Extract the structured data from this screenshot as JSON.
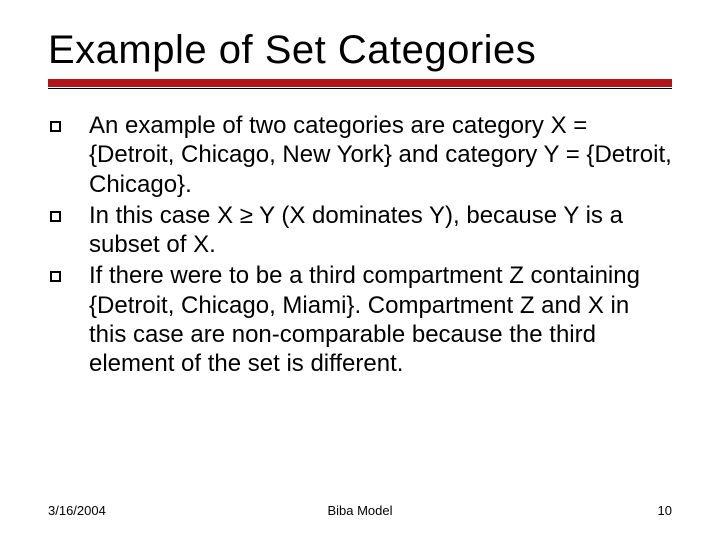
{
  "title": "Example of Set Categories",
  "bullets": [
    "An example of two categories are category X = {Detroit, Chicago, New York} and category Y = {Detroit, Chicago}.",
    "In this case X ≥ Y (X dominates Y), because Y is a subset of X.",
    "If there were to be a third compartment Z containing {Detroit, Chicago, Miami}. Compartment Z and X in this case are non-comparable because the third element of the set is different."
  ],
  "footer": {
    "date": "3/16/2004",
    "center": "Biba Model",
    "page": "10"
  }
}
